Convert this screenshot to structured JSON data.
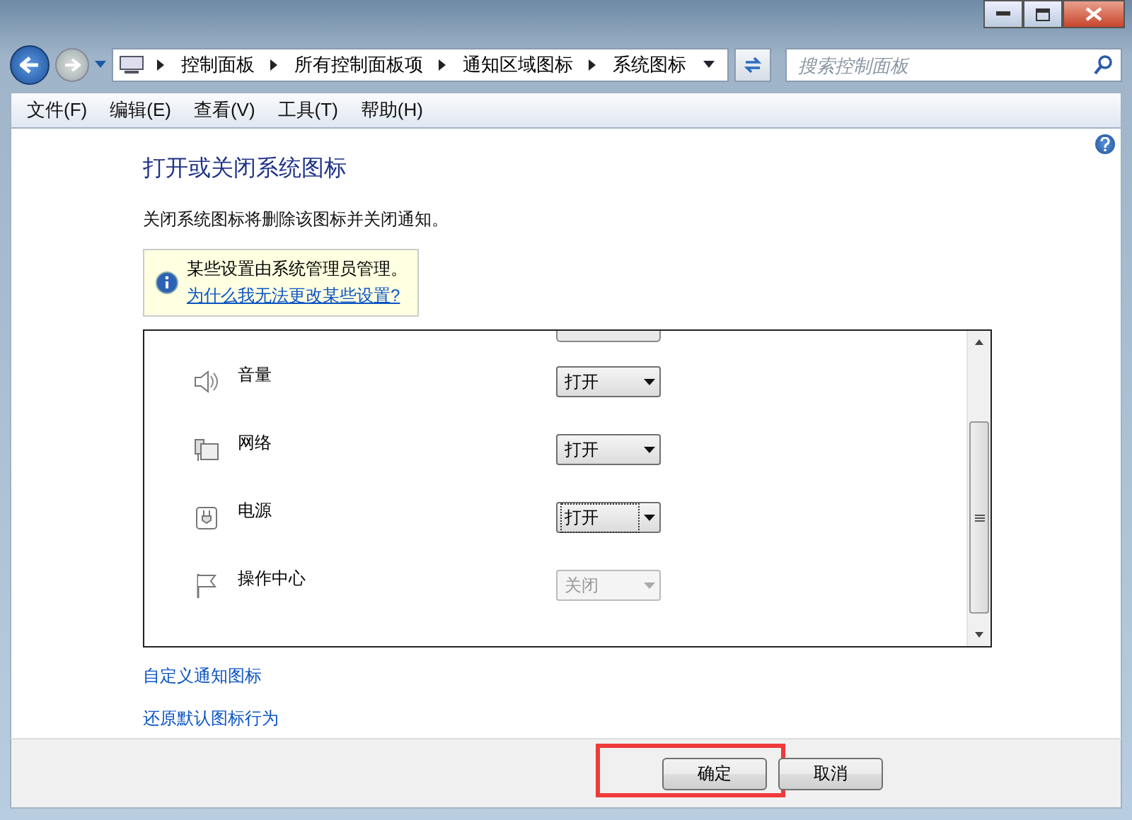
{
  "address_bar": {
    "breadcrumbs": [
      "控制面板",
      "所有控制面板项",
      "通知区域图标",
      "系统图标"
    ]
  },
  "search": {
    "placeholder": "搜索控制面板"
  },
  "menu": [
    {
      "label": "文件(F)"
    },
    {
      "label": "编辑(E)"
    },
    {
      "label": "查看(V)"
    },
    {
      "label": "工具(T)"
    },
    {
      "label": "帮助(H)"
    }
  ],
  "page": {
    "title": "打开或关闭系统图标",
    "description": "关闭系统图标将删除该图标并关闭通知。",
    "notice": {
      "message": "某些设置由系统管理员管理。",
      "link": "为什么我无法更改某些设置?"
    }
  },
  "icon_list": {
    "rows": [
      {
        "kind": "volume",
        "label": "音量",
        "value": "打开",
        "disabled": false,
        "focused": false
      },
      {
        "kind": "network",
        "label": "网络",
        "value": "打开",
        "disabled": false,
        "focused": false
      },
      {
        "kind": "power",
        "label": "电源",
        "value": "打开",
        "disabled": false,
        "focused": true
      },
      {
        "kind": "flag",
        "label": "操作中心",
        "value": "关闭",
        "disabled": true,
        "focused": false
      }
    ]
  },
  "links": [
    "自定义通知图标",
    "还原默认图标行为"
  ],
  "buttons": [
    {
      "label": "确定",
      "highlighted": true
    },
    {
      "label": "取消",
      "highlighted": false
    }
  ]
}
